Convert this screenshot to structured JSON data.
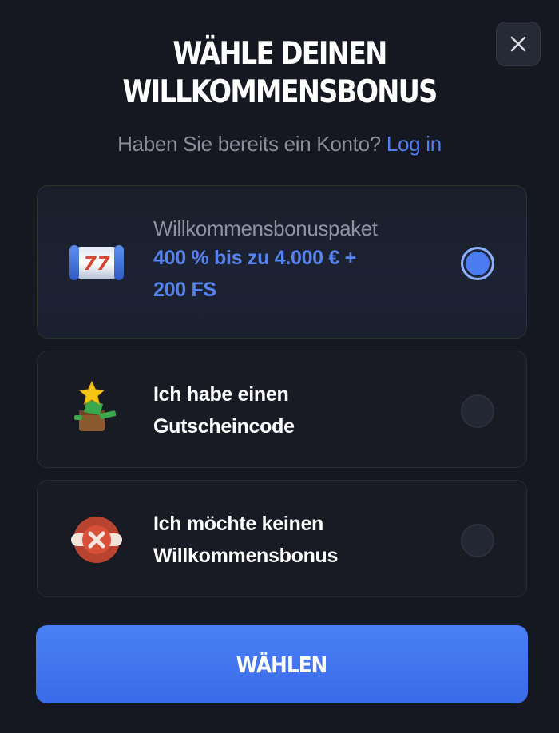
{
  "modal": {
    "title_line1": "WÄHLE DEINEN",
    "title_line2": "WILLKOMMENSBONUS",
    "subtitle_text": "Haben Sie bereits ein Konto?",
    "login_link": "Log in",
    "close_icon": "close-icon"
  },
  "options": [
    {
      "label": "Willkommensbonuspaket",
      "value_line1": "400 % bis zu 4.000 € +",
      "value_line2": "200 FS",
      "icon": "slot-reel-777-icon",
      "selected": true
    },
    {
      "title_line1": "Ich habe einen",
      "title_line2": "Gutscheincode",
      "icon": "gift-box-star-icon",
      "selected": false
    },
    {
      "title_line1": "Ich möchte keinen",
      "title_line2": "Willkommensbonus",
      "icon": "no-bonus-cross-icon",
      "selected": false
    }
  ],
  "cta": {
    "label": "WÄHLEN"
  },
  "colors": {
    "background": "#151821",
    "accent": "#4a7cf0",
    "link": "#4f7fee",
    "muted_text": "#8b8f9b"
  }
}
